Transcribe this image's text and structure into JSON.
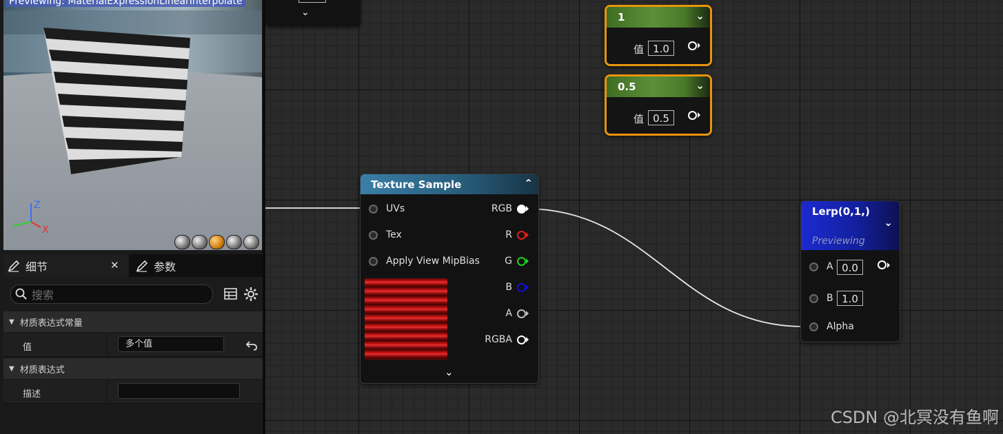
{
  "preview": {
    "title": "Previewing: MaterialExpressionLinearInterpolate",
    "axis_z": "Z",
    "axis_x": "X",
    "shape_buttons": [
      "cylinder-icon",
      "sphere-icon",
      "plane-icon",
      "cube-icon",
      "teapot-icon"
    ],
    "active_shape": "plane-icon"
  },
  "details": {
    "tab_details": "细节",
    "tab_params": "参数",
    "search_placeholder": "搜索",
    "category1": "材质表达式常量",
    "prop_value_label": "值",
    "prop_value": "多个值",
    "category2": "材质表达式",
    "prop_desc_label": "描述",
    "prop_desc_value": ""
  },
  "graph": {
    "const1": {
      "title": "1",
      "label": "值",
      "value": "1.0"
    },
    "const2": {
      "title": "0.5",
      "label": "值",
      "value": "0.5"
    },
    "texture": {
      "title": "Texture Sample",
      "inputs": [
        "UVs",
        "Tex",
        "Apply View MipBias"
      ],
      "outputs": [
        {
          "label": "RGB",
          "color": "#ffffff"
        },
        {
          "label": "R",
          "color": "#e02020"
        },
        {
          "label": "G",
          "color": "#20d020"
        },
        {
          "label": "B",
          "color": "#1010d0"
        },
        {
          "label": "A",
          "color": "#bdbdbd"
        },
        {
          "label": "RGBA",
          "color": "#ffffff"
        }
      ]
    },
    "lerp": {
      "title": "Lerp(0,1,)",
      "subtitle": "Previewing",
      "input_a_label": "A",
      "input_a_value": "0.0",
      "input_b_label": "B",
      "input_b_value": "1.0",
      "input_alpha_label": "Alpha"
    }
  },
  "watermark": "CSDN @北冥没有鱼啊"
}
